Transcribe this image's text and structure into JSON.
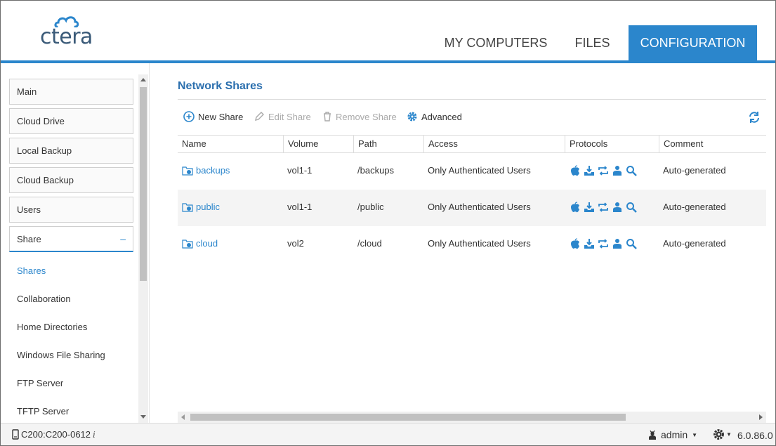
{
  "header": {
    "logo_text": "ctera",
    "tabs": [
      {
        "label": "MY COMPUTERS"
      },
      {
        "label": "FILES"
      },
      {
        "label": "CONFIGURATION"
      }
    ]
  },
  "sidebar": {
    "groups": [
      {
        "label": "Main"
      },
      {
        "label": "Cloud Drive"
      },
      {
        "label": "Local Backup"
      },
      {
        "label": "Cloud Backup"
      },
      {
        "label": "Users"
      },
      {
        "label": "Share",
        "toggle": "–"
      }
    ],
    "sub_items": [
      {
        "label": "Shares"
      },
      {
        "label": "Collaboration"
      },
      {
        "label": "Home Directories"
      },
      {
        "label": "Windows File Sharing"
      },
      {
        "label": "FTP Server"
      },
      {
        "label": "TFTP Server"
      }
    ]
  },
  "main": {
    "title": "Network Shares",
    "toolbar": {
      "new_share": "New Share",
      "edit_share": "Edit Share",
      "remove_share": "Remove Share",
      "advanced": "Advanced"
    },
    "columns": [
      "Name",
      "Volume",
      "Path",
      "Access",
      "Protocols",
      "Comment"
    ],
    "rows": [
      {
        "name": "backups",
        "volume": "vol1-1",
        "path": "/backups",
        "access": "Only Authenticated Users",
        "comment": "Auto-generated"
      },
      {
        "name": "public",
        "volume": "vol1-1",
        "path": "/public",
        "access": "Only Authenticated Users",
        "comment": "Auto-generated"
      },
      {
        "name": "cloud",
        "volume": "vol2",
        "path": "/cloud",
        "access": "Only Authenticated Users",
        "comment": "Auto-generated"
      }
    ],
    "protocol_icons": [
      "apple-icon",
      "nfs-download-icon",
      "rsync-icon",
      "user-icon",
      "search-icon"
    ]
  },
  "footer": {
    "device": "C200:C200-0612",
    "info_glyph": "i",
    "user": "admin",
    "version": "6.0.86.0"
  },
  "colors": {
    "accent": "#2b86cc",
    "title": "#2b6fae",
    "logo": "#3a5a78"
  }
}
